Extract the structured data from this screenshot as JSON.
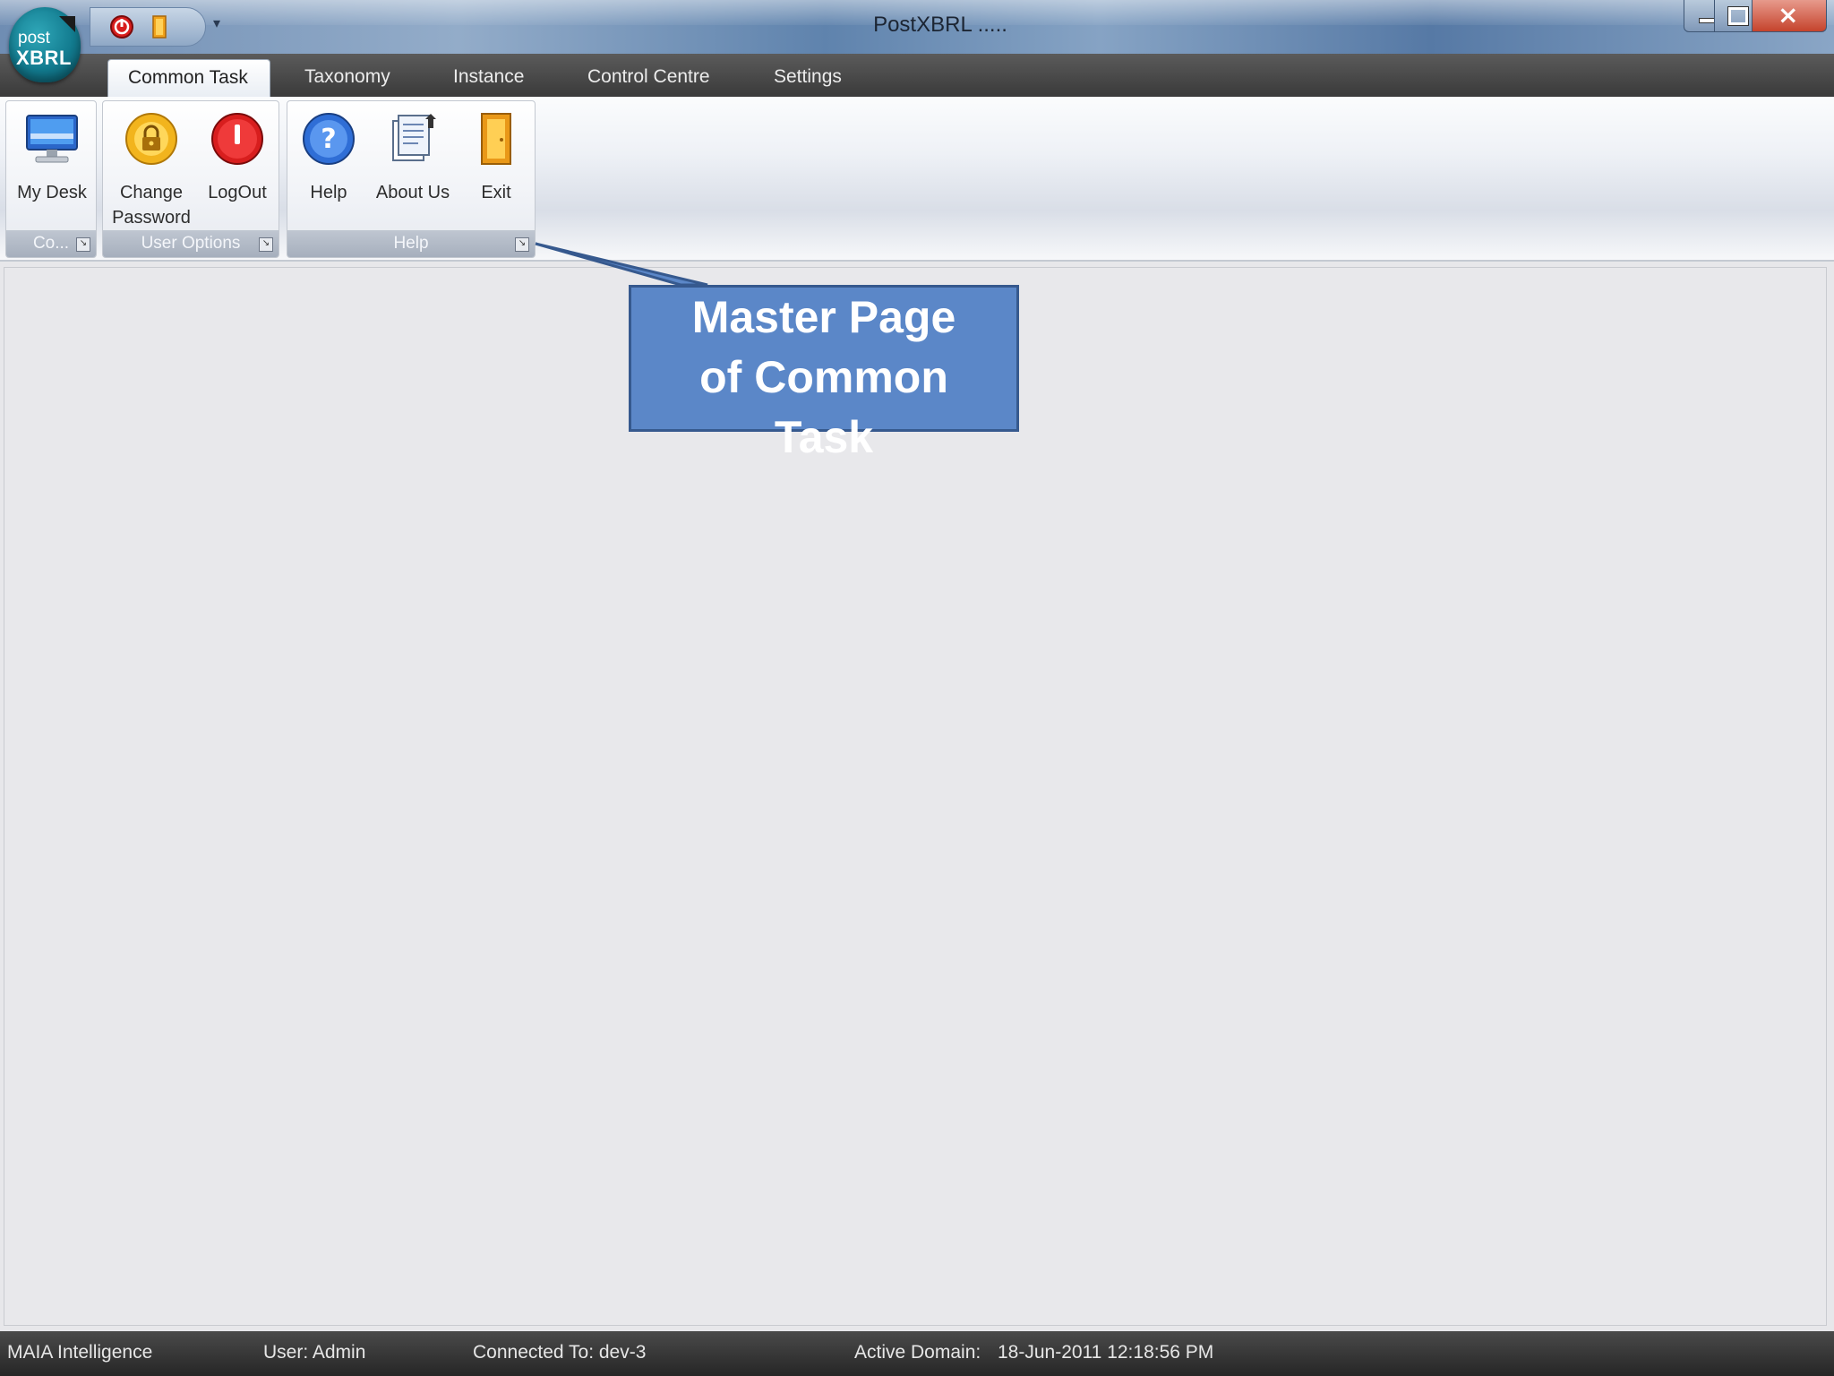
{
  "window": {
    "title": "PostXBRL .....",
    "logo_line1": "post",
    "logo_line2": "XBRL",
    "controls": {
      "minimize": "minimize-icon",
      "maximize": "maximize-icon",
      "close_glyph": "×"
    }
  },
  "quick_access": {
    "items": [
      {
        "icon": "logout-icon"
      },
      {
        "icon": "exit-door-icon"
      }
    ],
    "dropdown_glyph": "▾"
  },
  "tabs": [
    {
      "label": "Common Task",
      "active": true
    },
    {
      "label": "Taxonomy"
    },
    {
      "label": "Instance"
    },
    {
      "label": "Control Centre"
    },
    {
      "label": "Settings"
    }
  ],
  "ribbon": {
    "groups": [
      {
        "label": "Co...",
        "buttons": [
          {
            "label": "My Desk",
            "icon": "monitor-icon"
          }
        ]
      },
      {
        "label": "User Options",
        "buttons": [
          {
            "label": "Change\nPassword",
            "icon": "lock-icon"
          },
          {
            "label": "LogOut",
            "icon": "power-icon"
          }
        ]
      },
      {
        "label": "Help",
        "buttons": [
          {
            "label": "Help",
            "icon": "help-icon"
          },
          {
            "label": "About Us",
            "icon": "document-icon"
          },
          {
            "label": "Exit",
            "icon": "door-icon"
          }
        ]
      }
    ],
    "launcher_glyph": "↘"
  },
  "callout": {
    "lines": [
      "Master Page",
      "of Common",
      "Task"
    ],
    "color": "#5b87c8"
  },
  "statusbar": {
    "company": "MAIA Intelligence",
    "user": "User: Admin",
    "connected": "Connected To: dev-3",
    "active_domain": "Active Domain:",
    "datetime": "18-Jun-2011 12:18:56 PM"
  }
}
